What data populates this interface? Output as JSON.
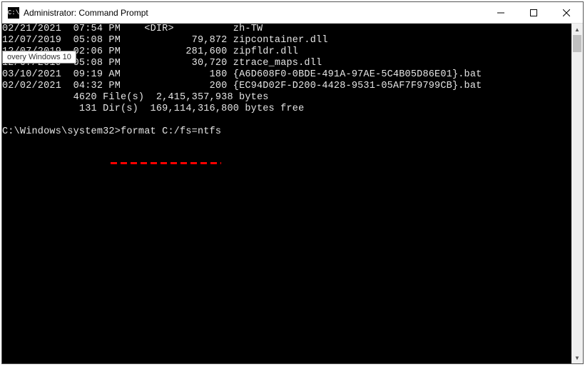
{
  "titlebar": {
    "icon_text": "C:\\",
    "title": "Administrator: Command Prompt"
  },
  "tooltip": {
    "text": "overy Windows 10"
  },
  "listing": [
    {
      "date": "02/21/2021",
      "time": "07:54 PM",
      "size_or_dir": "<DIR>         ",
      "name": "zh-TW"
    },
    {
      "date": "12/07/2019",
      "time": "05:08 PM",
      "size_or_dir": "        79,872",
      "name": "zipcontainer.dll"
    },
    {
      "date": "12/07/2019",
      "time": "02:06 PM",
      "size_or_dir": "       281,600",
      "name": "zipfldr.dll"
    },
    {
      "date": "12/07/2019",
      "time": "05:08 PM",
      "size_or_dir": "        30,720",
      "name": "ztrace_maps.dll"
    },
    {
      "date": "03/10/2021",
      "time": "09:19 AM",
      "size_or_dir": "           180",
      "name": "{A6D608F0-0BDE-491A-97AE-5C4B05D86E01}.bat"
    },
    {
      "date": "02/02/2021",
      "time": "04:32 PM",
      "size_or_dir": "           200",
      "name": "{EC94D02F-D200-4428-9531-05AF7F9799CB}.bat"
    }
  ],
  "summary": {
    "files_line": "            4620 File(s)  2,415,357,938 bytes",
    "dirs_line": "             131 Dir(s)  169,114,316,800 bytes free"
  },
  "prompt": {
    "path": "C:\\Windows\\system32>",
    "command": "format C:/fs=ntfs"
  }
}
